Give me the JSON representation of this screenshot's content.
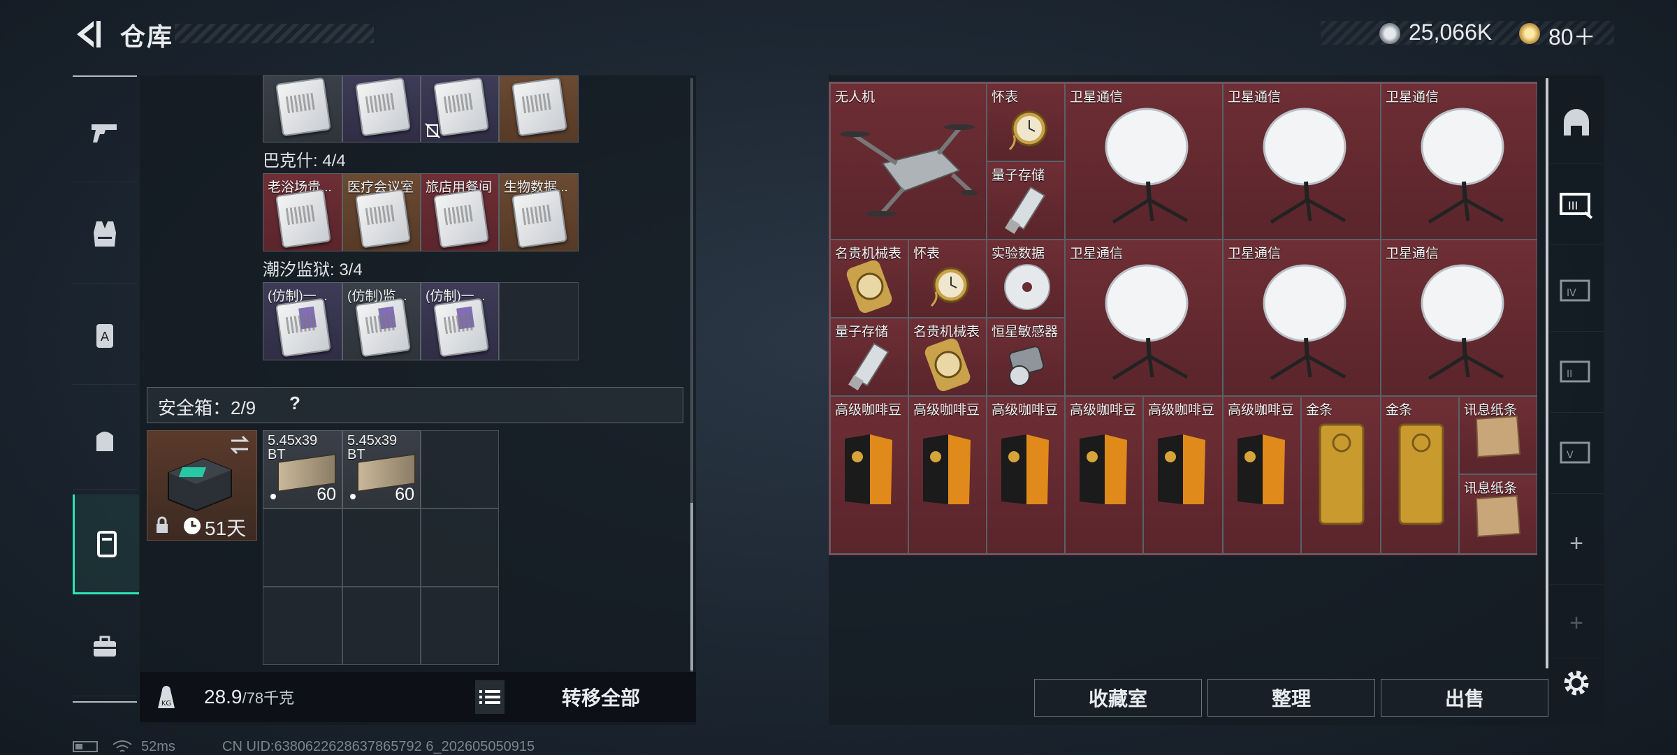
{
  "header": {
    "title": "仓库",
    "currency_silver": "25,066K",
    "currency_gold": "80＋"
  },
  "left": {
    "top_row": [
      {
        "color": "grey"
      },
      {
        "color": "purple"
      },
      {
        "color": "purple"
      },
      {
        "color": "brown"
      }
    ],
    "group1": {
      "title": "巴克什: 4/4",
      "items": [
        {
          "label": "老浴场贵...",
          "color": "red"
        },
        {
          "label": "医疗会议室",
          "color": "brown"
        },
        {
          "label": "旅店用餐间",
          "color": "red"
        },
        {
          "label": "生物数据...",
          "color": "brown"
        }
      ]
    },
    "group2": {
      "title": "潮汐监狱: 3/4",
      "items": [
        {
          "label": "(仿制)一...",
          "color": "purple"
        },
        {
          "label": "(仿制)监...",
          "color": "grey"
        },
        {
          "label": "(仿制)一...",
          "color": "purple"
        }
      ]
    },
    "safe": {
      "title": "安全箱：2/9",
      "help": "?",
      "timer": "51天",
      "ammo": [
        {
          "label": "5.45x39 BT",
          "count": "60"
        },
        {
          "label": "5.45x39 BT",
          "count": "60"
        }
      ]
    },
    "weight": {
      "current": "28.9",
      "max": "/78千克"
    },
    "transfer_label": "转移全部"
  },
  "right": {
    "items": [
      {
        "id": "drone",
        "label": "无人机"
      },
      {
        "id": "watch1",
        "label": "怀表"
      },
      {
        "id": "qs1",
        "label": "量子存储"
      },
      {
        "id": "sat1",
        "label": "卫星通信"
      },
      {
        "id": "sat2",
        "label": "卫星通信"
      },
      {
        "id": "sat3",
        "label": "卫星通信"
      },
      {
        "id": "mw1",
        "label": "名贵机械表"
      },
      {
        "id": "watch2",
        "label": "怀表"
      },
      {
        "id": "disc",
        "label": "实验数据"
      },
      {
        "id": "qs2",
        "label": "量子存储"
      },
      {
        "id": "mw2",
        "label": "名贵机械表"
      },
      {
        "id": "sensor",
        "label": "恒星敏感器"
      },
      {
        "id": "sat4",
        "label": "卫星通信"
      },
      {
        "id": "sat5",
        "label": "卫星通信"
      },
      {
        "id": "sat6",
        "label": "卫星通信"
      },
      {
        "id": "c1",
        "label": "高级咖啡豆"
      },
      {
        "id": "c2",
        "label": "高级咖啡豆"
      },
      {
        "id": "c3",
        "label": "高级咖啡豆"
      },
      {
        "id": "c4",
        "label": "高级咖啡豆"
      },
      {
        "id": "c5",
        "label": "高级咖啡豆"
      },
      {
        "id": "c6",
        "label": "高级咖啡豆"
      },
      {
        "id": "g1",
        "label": "金条"
      },
      {
        "id": "g2",
        "label": "金条"
      },
      {
        "id": "p1",
        "label": "讯息纸条"
      },
      {
        "id": "p2",
        "label": "讯息纸条"
      }
    ],
    "buttons": {
      "collection": "收藏室",
      "organize": "整理",
      "sell": "出售"
    }
  },
  "rnav": {
    "add1": "+",
    "add2": "+"
  },
  "footer": {
    "ping": "52ms",
    "uid": "CN UID:6380622628637865792 6_202605050915"
  },
  "colors": {
    "accent": "#2ee3b8",
    "grid_red": "#6a2c33"
  }
}
